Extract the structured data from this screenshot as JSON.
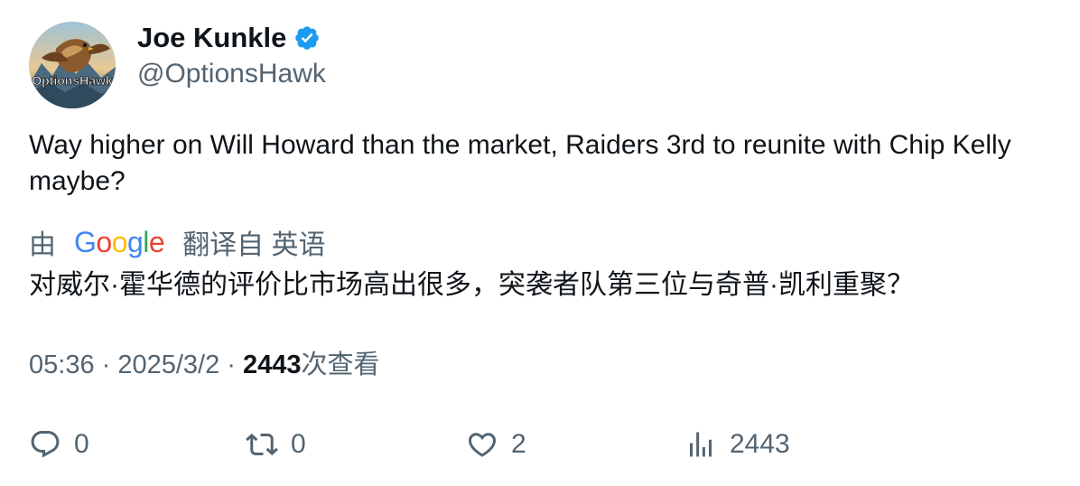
{
  "author": {
    "display_name": "Joe Kunkle",
    "handle": "@OptionsHawk",
    "avatar_text": "OptionsHawk",
    "verified": true
  },
  "tweet": {
    "text": "Way higher on Will Howard than the market, Raiders 3rd to reunite with Chip Kelly maybe?"
  },
  "translation": {
    "prefix": "由",
    "provider": "Google",
    "suffix": "翻译自 英语",
    "text": "对威尔·霍华德的评价比市场高出很多，突袭者队第三位与奇普·凯利重聚？"
  },
  "meta": {
    "time": "05:36",
    "separator": " · ",
    "date": "2025/3/2",
    "views_count": "2443",
    "views_label": "次查看"
  },
  "actions": {
    "reply_count": "0",
    "retweet_count": "0",
    "like_count": "2",
    "views_count": "2443"
  },
  "colors": {
    "text_primary": "#0f1419",
    "text_secondary": "#536471",
    "verified_badge": "#1d9bf0"
  }
}
